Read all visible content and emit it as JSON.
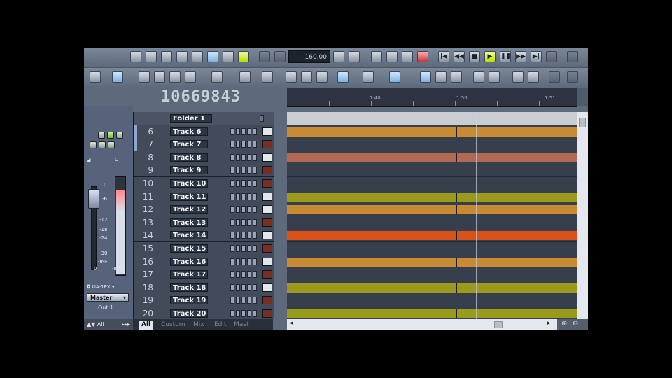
{
  "toolbar": {
    "tempo_display": "160.00"
  },
  "counter": "10669843",
  "ruler": {
    "labels": [
      "1:40",
      "1:50",
      "1:51"
    ]
  },
  "left_panel": {
    "db_labels": [
      "0",
      "-6",
      "-12",
      "-18",
      "-24",
      "-30",
      "-INF"
    ],
    "meter_label": "-INF",
    "fader_label": "0",
    "device": "UA-1EX",
    "master": "Master",
    "output": "Out 1",
    "bottom_label": "All"
  },
  "folder": {
    "name": "Folder 1"
  },
  "tracks": [
    {
      "num": "6",
      "name": "Track 6",
      "color": "#e3e6ea",
      "clip": "#c98a34"
    },
    {
      "num": "7",
      "name": "Track 7",
      "color": "#7a2e22",
      "clip": ""
    },
    {
      "num": "8",
      "name": "Track 8",
      "color": "#e3e6ea",
      "clip": "#b26a55"
    },
    {
      "num": "9",
      "name": "Track 9",
      "color": "#7a2e22",
      "clip": ""
    },
    {
      "num": "10",
      "name": "Track 10",
      "color": "#7a2e22",
      "clip": ""
    },
    {
      "num": "11",
      "name": "Track 11",
      "color": "#e3e6ea",
      "clip": "#9a9b1c"
    },
    {
      "num": "12",
      "name": "Track 12",
      "color": "#e3e6ea",
      "clip": "#c98a34"
    },
    {
      "num": "13",
      "name": "Track 13",
      "color": "#7a2e22",
      "clip": ""
    },
    {
      "num": "14",
      "name": "Track 14",
      "color": "#e3e6ea",
      "clip": "#d9521a"
    },
    {
      "num": "15",
      "name": "Track 15",
      "color": "#7a2e22",
      "clip": ""
    },
    {
      "num": "16",
      "name": "Track 16",
      "color": "#e3e6ea",
      "clip": "#c98a34"
    },
    {
      "num": "17",
      "name": "Track 17",
      "color": "#7a2e22",
      "clip": ""
    },
    {
      "num": "18",
      "name": "Track 18",
      "color": "#e3e6ea",
      "clip": "#9a9b1c"
    },
    {
      "num": "19",
      "name": "Track 19",
      "color": "#7a2e22",
      "clip": ""
    },
    {
      "num": "20",
      "name": "Track 20",
      "color": "#7a2e22",
      "clip": "#9a9b1c"
    }
  ],
  "tabs": [
    "All",
    "Custom",
    "Mix",
    "Edit",
    "Mast"
  ],
  "colors": {
    "app_bg": "#5d6a7b",
    "play_accent": "#b6e000",
    "arrange_bg": "#2e3541"
  }
}
